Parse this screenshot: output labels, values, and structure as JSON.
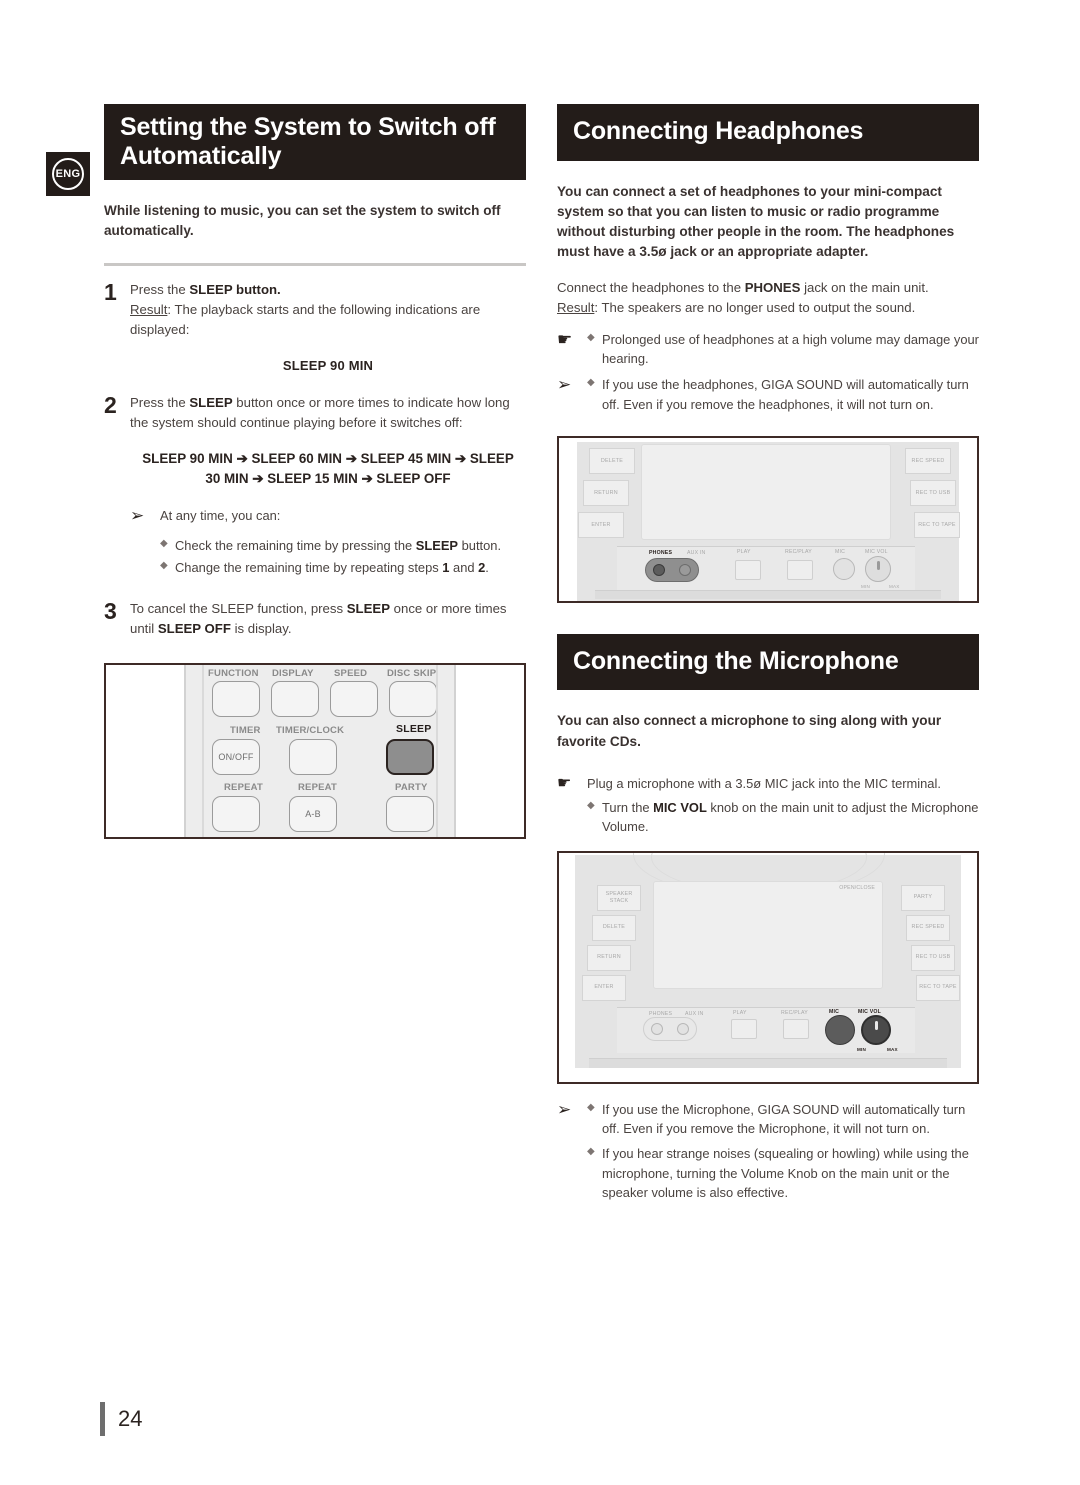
{
  "page": {
    "number": "24",
    "language_badge": "ENG"
  },
  "left_column": {
    "heading": "Setting the System to Switch off Automatically",
    "intro": "While listening to music, you can set the system to switch off automatically.",
    "steps": [
      {
        "number": "1",
        "line1_pre": "Press the ",
        "line1_bold": "SLEEP",
        "line1_post": " button.",
        "result_label": "Result",
        "result_text": ": The playback starts and the following indications are displayed:",
        "display_value": "SLEEP 90 MIN"
      },
      {
        "number": "2",
        "line1_pre": "Press the ",
        "line1_bold": "SLEEP",
        "line1_post": " button once or more times to indicate how long the system should continue playing before it switches off:",
        "sequence_line1": "SLEEP 90 MIN ➔ SLEEP 60 MIN ➔ SLEEP 45 MIN ➔ SLEEP",
        "sequence_line2": "30 MIN ➔ SLEEP 15 MIN ➔ SLEEP OFF",
        "note_icon": "arrow-pointer-icon",
        "note_text": "At any time, you can:",
        "bullets": [
          {
            "pre": "Check the remaining time by pressing the ",
            "bold": "SLEEP",
            "post": " button."
          },
          {
            "pre": "Change the remaining time by repeating steps ",
            "bold": "1",
            "mid": " and ",
            "bold2": "2",
            "post": "."
          }
        ]
      },
      {
        "number": "3",
        "line1_pre": "To cancel the SLEEP function, press ",
        "line1_bold": "SLEEP",
        "line1_post": " once or more times until ",
        "line2_bold": "SLEEP OFF",
        "line2_post": " is display."
      }
    ],
    "remote_figure": {
      "name": "remote-control-figure",
      "labels_row1": [
        "FUNCTION",
        "DISPLAY",
        "SPEED",
        "DISC SKIP"
      ],
      "labels_row2": [
        "TIMER",
        "TIMER/CLOCK",
        "SLEEP"
      ],
      "buttons_row2": [
        "ON/OFF",
        "",
        ""
      ],
      "labels_row3": [
        "REPEAT",
        "REPEAT",
        "PARTY"
      ],
      "buttons_row3": [
        "",
        "A-B",
        ""
      ],
      "highlighted_button": "SLEEP"
    }
  },
  "right_column": {
    "headphones": {
      "heading": "Connecting Headphones",
      "intro": "You can connect a set of headphones to your mini-compact system so that you can listen to music or radio programme without disturbing other people in the room. The headphones must have a 3.5ø jack or an appropriate adapter.",
      "connect_pre": "Connect the headphones to the ",
      "connect_bold": "PHONES",
      "connect_post": " jack on the main unit.",
      "result_label": "Result",
      "result_text": ": The speakers are no longer used to output the sound.",
      "notes": [
        {
          "icon": "pointing-hand-icon",
          "text": "Prolonged use of headphones at a high volume may damage your hearing."
        },
        {
          "icon": "arrow-pointer-icon",
          "text": "If you use the headphones, GIGA SOUND will automatically turn off. Even if you remove the headphones, it will not turn on."
        }
      ],
      "figure": {
        "name": "main-unit-phones-jack-figure",
        "left_buttons": [
          "DELETE",
          "RETURN",
          "ENTER"
        ],
        "right_buttons": [
          "REC SPEED",
          "REC TO USB",
          "REC TO TAPE"
        ],
        "jack_labels": [
          "PHONES",
          "AUX IN",
          "PLAY",
          "REC/PLAY",
          "MIC",
          "MIC VOL"
        ],
        "knob_min": "MIN",
        "knob_max": "MAX",
        "highlight": "PHONES"
      }
    },
    "microphone": {
      "heading": "Connecting the Microphone",
      "intro": "You can also connect a microphone to sing along with your favorite CDs.",
      "note_icon": "pointing-hand-icon",
      "note_text": "Plug a microphone with a 3.5ø MIC jack into the MIC terminal.",
      "bullet": {
        "pre": "Turn the ",
        "bold": "MIC VOL",
        "post": " knob on the main unit to adjust the Microphone Volume."
      },
      "figure": {
        "name": "main-unit-mic-jack-figure",
        "open_close_label": "OPEN/CLOSE",
        "left_buttons": [
          "SPEAKER STACK",
          "DELETE",
          "RETURN",
          "ENTER"
        ],
        "right_buttons": [
          "PARTY",
          "REC SPEED",
          "REC TO USB",
          "REC TO TAPE"
        ],
        "jack_labels": [
          "PHONES",
          "AUX IN",
          "PLAY",
          "REC/PLAY",
          "MIC",
          "MIC VOL"
        ],
        "knob_min": "MIN",
        "knob_max": "MAX",
        "highlight": "MIC / MIC VOL"
      },
      "notes": [
        {
          "icon": "arrow-pointer-icon",
          "text": "If you use the Microphone, GIGA SOUND will automatically turn off. Even if you remove the Microphone, it will not turn on."
        },
        {
          "icon": "",
          "text": "If you hear strange noises (squealing or howling) while using the microphone, turning  the Volume Knob on the main unit or the speaker volume is also effective."
        }
      ]
    }
  },
  "glyphs": {
    "arrow_pointer": "➢",
    "pointing_hand": "☛",
    "diamond_bullet": "◆",
    "eject": "▲"
  }
}
